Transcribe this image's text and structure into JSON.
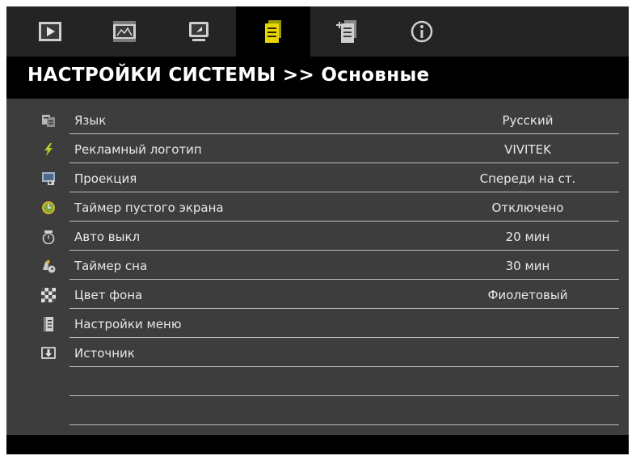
{
  "tabs": [
    {
      "name": "tab-image",
      "icon": "image-play-icon"
    },
    {
      "name": "tab-display",
      "icon": "display-film-icon"
    },
    {
      "name": "tab-advanced",
      "icon": "monitor-icon"
    },
    {
      "name": "tab-system-settings",
      "icon": "system-settings-icon",
      "active": true
    },
    {
      "name": "tab-system-advanced",
      "icon": "system-advanced-icon"
    },
    {
      "name": "tab-information",
      "icon": "info-icon"
    }
  ],
  "header": {
    "title": "НАСТРОЙКИ СИСТЕМЫ >> Основные"
  },
  "menu": {
    "items": [
      {
        "label": "Язык",
        "value": "Русский",
        "icon": "language-icon"
      },
      {
        "label": "Рекламный логотип",
        "value": "VIVITEK",
        "icon": "logo-flash-icon"
      },
      {
        "label": "Проекция",
        "value": "Спереди на ст.",
        "icon": "projection-icon"
      },
      {
        "label": "Таймер пустого экрана",
        "value": "Отключено",
        "icon": "blank-timer-icon"
      },
      {
        "label": "Авто выкл",
        "value": "20 мин",
        "icon": "auto-off-icon"
      },
      {
        "label": "Таймер сна",
        "value": "30 мин",
        "icon": "sleep-timer-icon"
      },
      {
        "label": "Цвет фона",
        "value": "Фиолетовый",
        "icon": "background-color-icon"
      },
      {
        "label": "Настройки меню",
        "value": "",
        "icon": "menu-settings-icon"
      },
      {
        "label": "Источник",
        "value": "",
        "icon": "source-icon"
      }
    ]
  },
  "colors": {
    "accent_yellow": "#e8d400",
    "background": "#3d3d3d",
    "header": "#000000"
  }
}
